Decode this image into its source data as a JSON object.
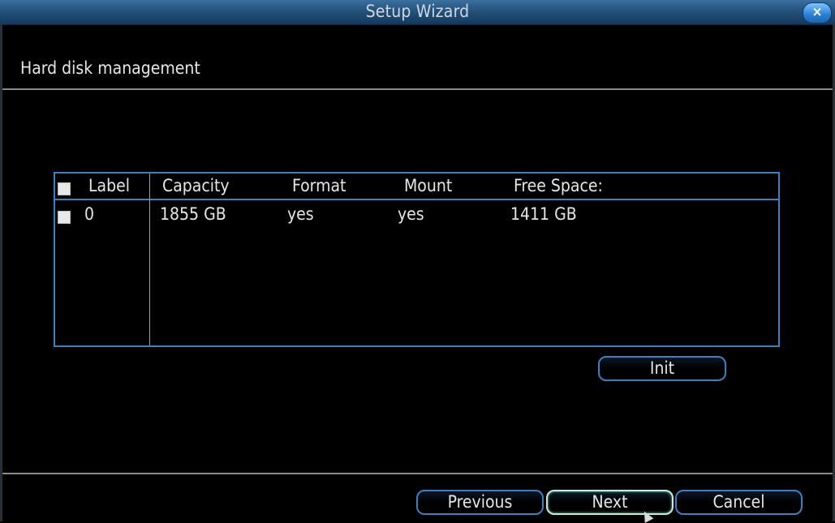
{
  "window": {
    "title": "Setup Wizard",
    "close_symbol": "×"
  },
  "section": {
    "title": "Hard disk management"
  },
  "table": {
    "headers": {
      "label": "Label",
      "capacity": "Capacity",
      "format": "Format",
      "mount": "Mount",
      "free_space": "Free Space:"
    },
    "rows": [
      {
        "label": "0",
        "capacity": "1855 GB",
        "format": "yes",
        "mount": "yes",
        "free_space": "1411 GB"
      }
    ]
  },
  "buttons": {
    "init": "Init",
    "previous": "Previous",
    "next": "Next",
    "cancel": "Cancel"
  },
  "colors": {
    "accent": "#3d7fc1",
    "titlebar": "#234f78",
    "background": "#000000"
  }
}
